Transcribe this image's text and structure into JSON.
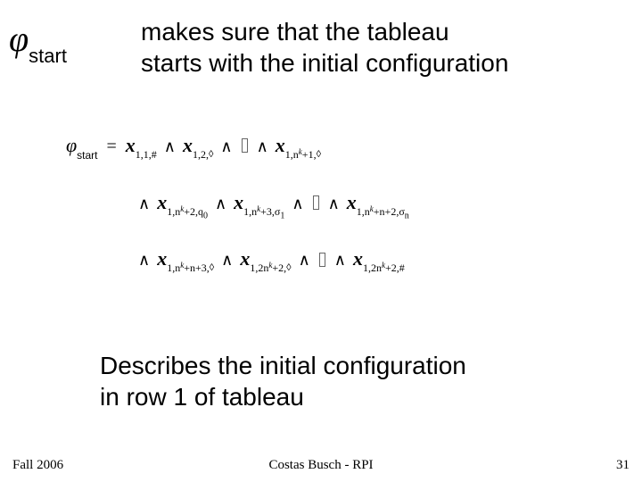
{
  "header": {
    "phi_symbol": "φ",
    "phi_subscript": "start",
    "top_line_1": "makes sure that the tableau",
    "top_line_2": "starts with the initial configuration"
  },
  "formula": {
    "lhs_phi": "φ",
    "lhs_sub": "start",
    "eq": "=",
    "and": "∧",
    "ellipsis_box": " ",
    "x": "x",
    "sub_1_1_hash": "1,1,#",
    "sub_1_2_d": "1,2,",
    "diamond": "◊",
    "sub_1_nk1_d_a": "1,n",
    "sub_1_nk1_d_b": "+1,",
    "sub_1_nk2_q0_a": "1,n",
    "sub_1_nk2_q0_b": "+2,q",
    "sub_q0_zero": "0",
    "sub_1_nk3_s1_a": "1,n",
    "sub_1_nk3_s1_b": "+3,σ",
    "sub_s1_one": "1",
    "sub_1_nkn2_sn_a": "1,n",
    "sub_1_nkn2_sn_b": "+n+2,σ",
    "sub_sn_n": "n",
    "sub_1_nkn3_d_a": "1,n",
    "sub_1_nkn3_d_b": "+n+3,",
    "sub_1_2nk2_d_a": "1,2n",
    "sub_1_2nk2_d_b": "+2,",
    "sub_1_2nk2_h_a": "1,2n",
    "sub_1_2nk2_h_b": "+2,#",
    "supk": "k"
  },
  "description": {
    "line1": "Describes the initial configuration",
    "line2": "in row 1 of tableau"
  },
  "footer": {
    "left": "Fall 2006",
    "center": "Costas Busch - RPI",
    "right": "31"
  }
}
